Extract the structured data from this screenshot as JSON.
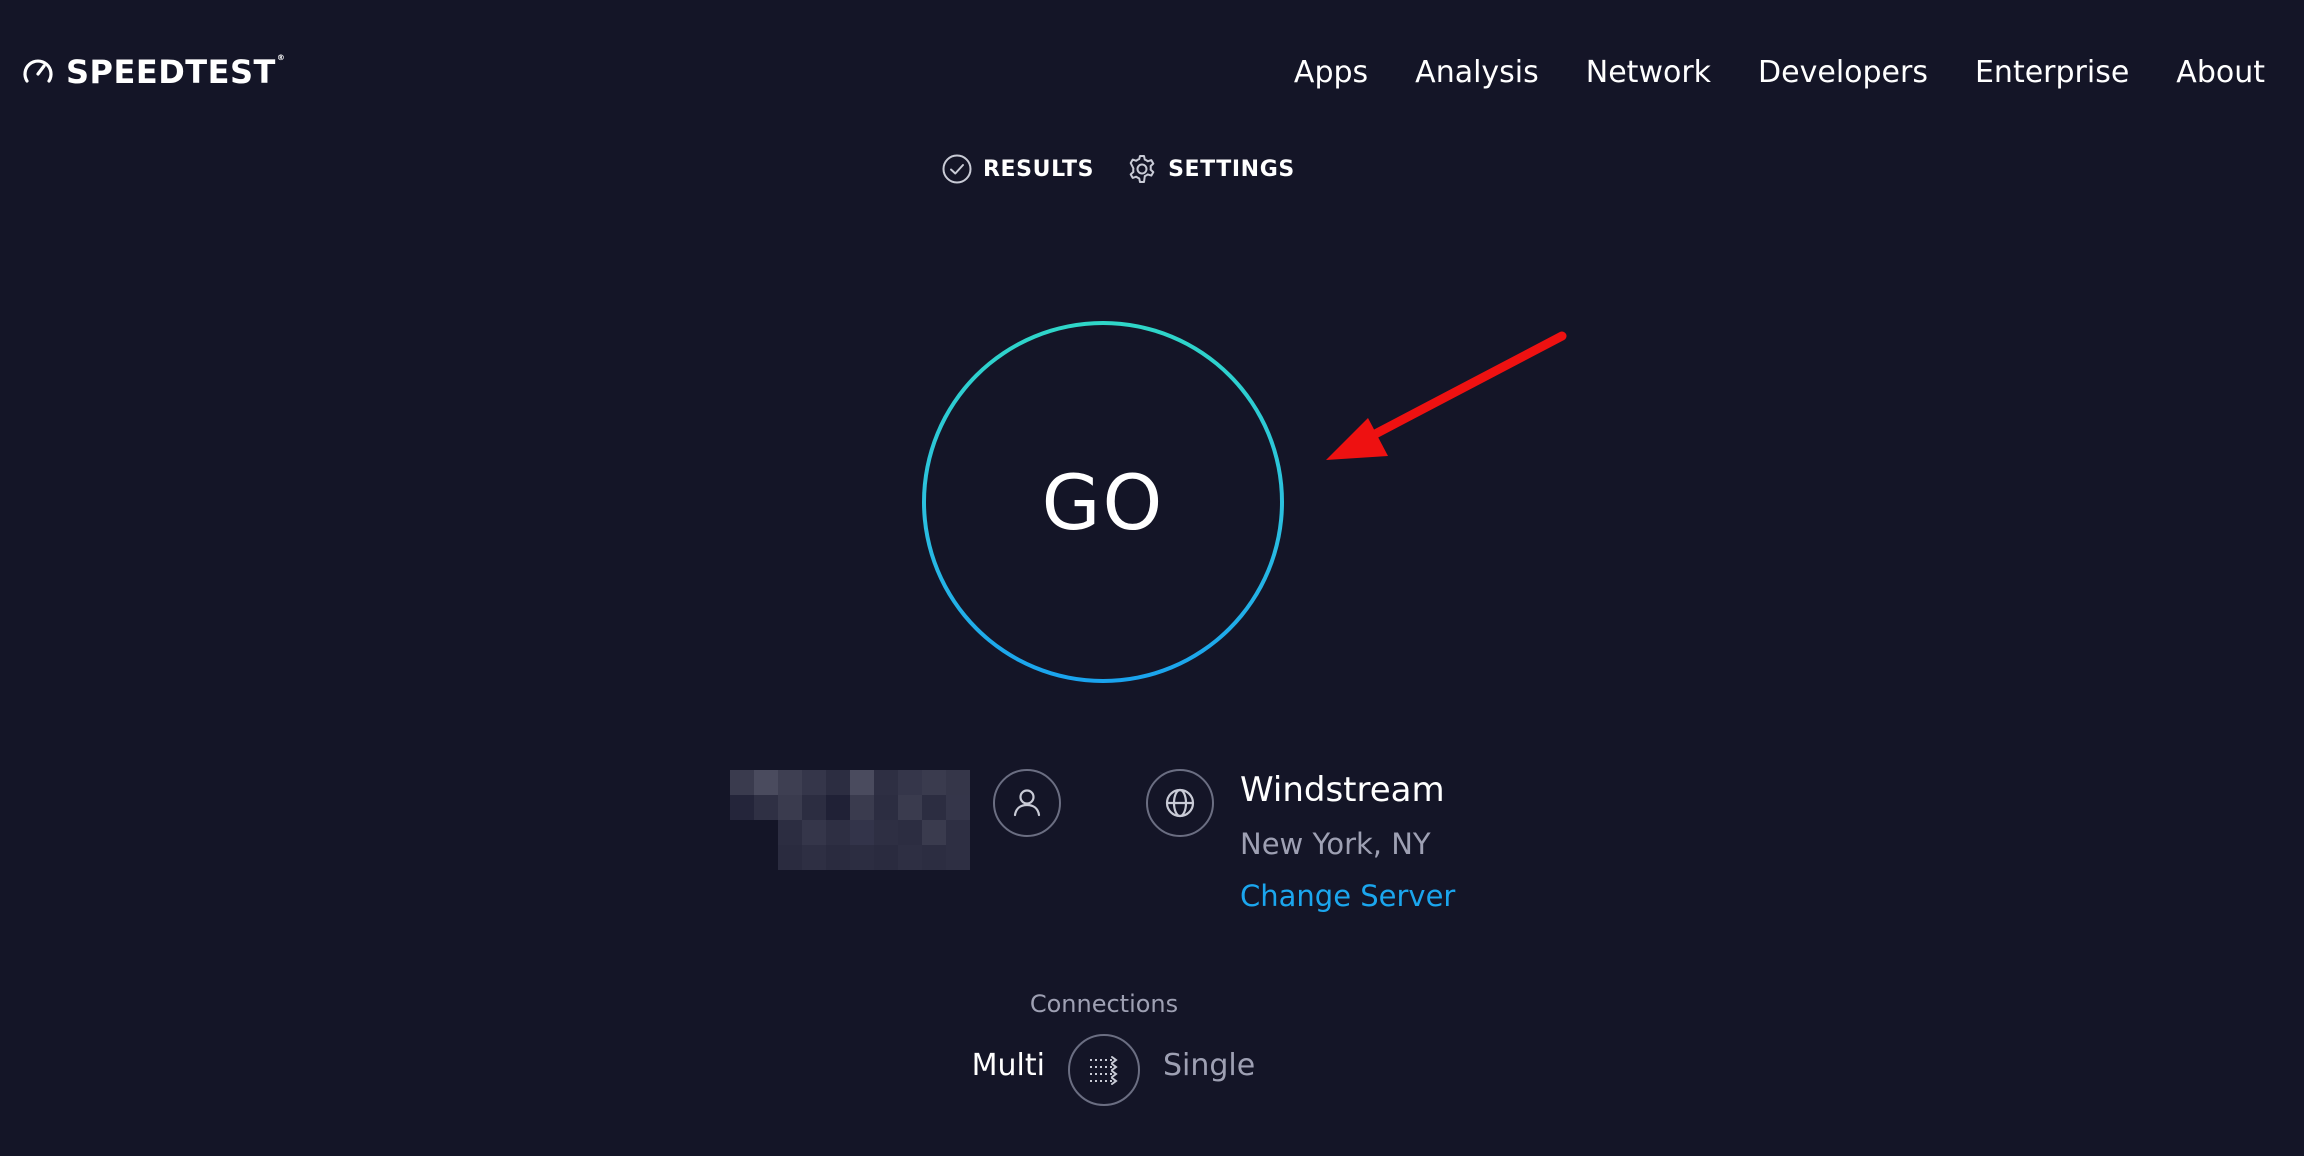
{
  "brand": {
    "name": "SPEEDTEST",
    "trademark": "®"
  },
  "nav": {
    "items": [
      "Apps",
      "Analysis",
      "Network",
      "Developers",
      "Enterprise",
      "About"
    ]
  },
  "subnav": {
    "results_label": "RESULTS",
    "settings_label": "SETTINGS"
  },
  "go_button": {
    "label": "GO"
  },
  "server": {
    "name": "Windstream",
    "location": "New York, NY",
    "change_label": "Change Server"
  },
  "connections": {
    "label": "Connections",
    "multi_label": "Multi",
    "single_label": "Single",
    "selected": "Multi"
  },
  "colors": {
    "background": "#141527",
    "ring_top": "#2fd6c8",
    "ring_bottom": "#1aa3ee",
    "link": "#1ba6ee",
    "annotation_arrow": "#ee1111"
  }
}
